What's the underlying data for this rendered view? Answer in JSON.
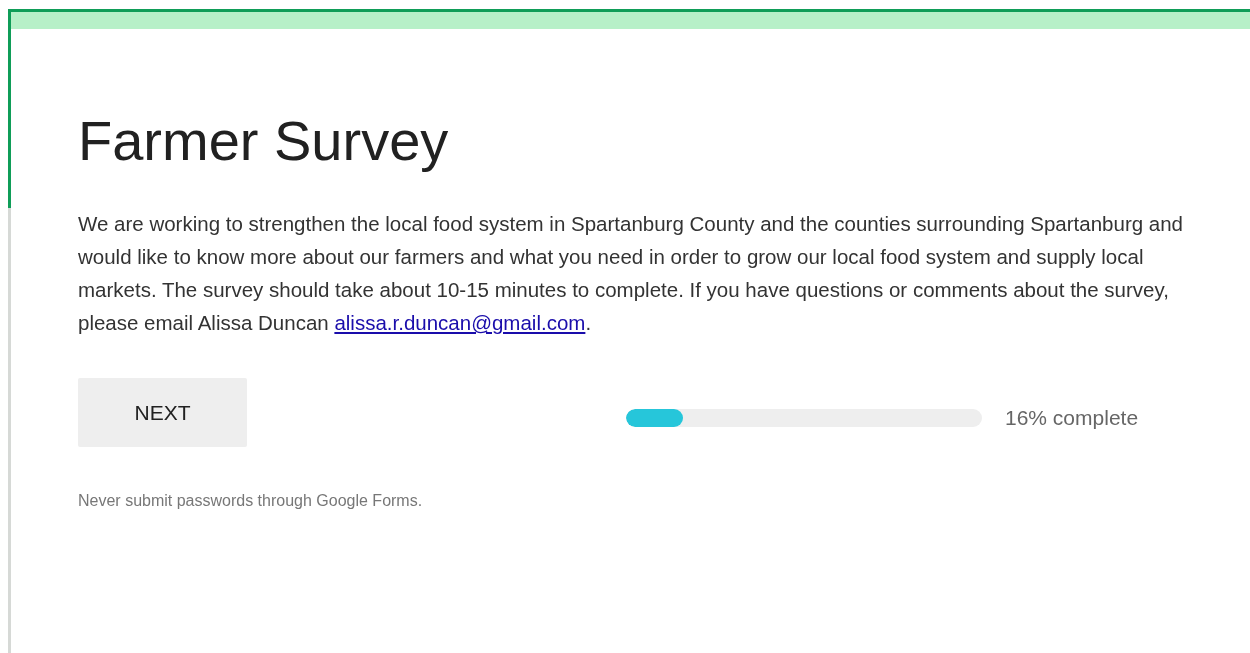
{
  "form": {
    "title": "Farmer Survey",
    "description": {
      "text": "We are working to strengthen the local food system in Spartanburg County and the counties surrounding Spartanburg and would like to know more about our farmers and what you need in order to grow our local food system and supply local markets. The survey should take about 10-15 minutes to complete. If you have questions or comments about the survey, please email Alissa Duncan ",
      "link": "alissa.r.duncan@gmail.com",
      "after": "."
    },
    "next_button": "NEXT",
    "progress": {
      "level": 0.16,
      "label": "16% complete"
    },
    "footer": "Never submit passwords through Google Forms."
  }
}
